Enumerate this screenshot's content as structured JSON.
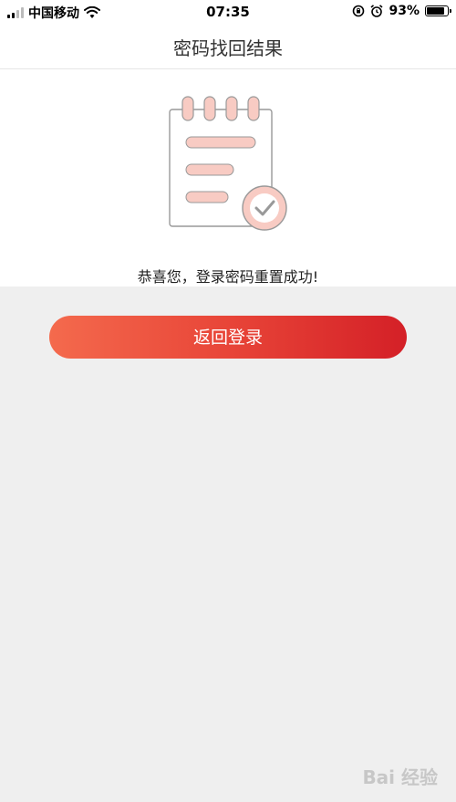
{
  "status_bar": {
    "carrier": "中国移动",
    "time": "07:35",
    "battery_percent": "93%",
    "battery_level": 0.93,
    "icons": [
      "signal-icon",
      "wifi-icon",
      "rotation-lock-icon",
      "alarm-icon",
      "battery-icon"
    ]
  },
  "nav": {
    "title": "密码找回结果"
  },
  "illustration": {
    "icon": "notepad-check-icon"
  },
  "message": "恭喜您，登录密码重置成功!",
  "button": {
    "label": "返回登录"
  },
  "watermark": "Bai 经验",
  "colors": {
    "button_start": "#f46a4d",
    "button_end": "#d42027",
    "illustration_accent": "#f8cbc3",
    "background": "#efefef"
  }
}
